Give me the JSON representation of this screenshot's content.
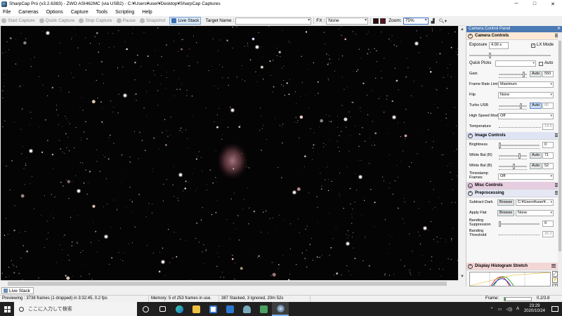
{
  "window": {
    "title": "SharpCap Pro (v3.2.6383) - ZWO ASI462MC (via USB2) - C:¥Users¥user¥Desktop¥SharpCap Captures",
    "minimize": "─",
    "maximize": "□",
    "close": "✕"
  },
  "menu": [
    "File",
    "Cameras",
    "Options",
    "Capture",
    "Tools",
    "Scripting",
    "Help"
  ],
  "toolbar": {
    "start_capture": "Start Capture",
    "quick_capture": "Quick Capture",
    "stop_capture": "Stop Capture",
    "pause": "Pause",
    "snapshot": "Snapshot",
    "live_stack": "Live Stack",
    "target_name_label": "Target Name :",
    "target_name_value": "",
    "fx_label": "FX :",
    "fx_value": "None",
    "zoom_label": "Zoom:",
    "zoom_value": "75%"
  },
  "viewer": {
    "nebula_color": "#b0707a"
  },
  "live_stack_tab": "Live Stack",
  "status": {
    "previewing": "Previewing : 3738 frames (1 dropped) in 3:32:45, 0.2 fps",
    "memory": "Memory: 5 of 253 frames in use.",
    "stacked": "387 Stacked, 3 Ignored, 20m 52s",
    "frame_label": "Frame:",
    "frame_value": "0.2/3.8",
    "frame_fraction": 0.05
  },
  "taskbar": {
    "search_placeholder": "ここに入力して検索",
    "time": "23:29",
    "date": "2020/10/24",
    "ime": "A",
    "icons": [
      "task-view-icon",
      "edge-icon",
      "file-explorer-icon",
      "store-icon",
      "mail-icon",
      "photos-icon",
      "app-icon",
      "sharpcap-icon"
    ]
  },
  "panel": {
    "title": "Camera Control Panel",
    "pin": "✕",
    "camera_controls": {
      "header": "Camera Controls",
      "exposure_label": "Exposure",
      "exposure_value": "4.00 s",
      "lx_mode_label": "LX Mode",
      "lx_mode_checked": "✓",
      "quick_picks_label": "Quick Picks",
      "quick_picks_value": "",
      "auto_label": "Auto",
      "gain_label": "Gain",
      "gain_auto": "Auto",
      "gain_value": "550",
      "frame_rate_limit_label": "Frame Rate Limit",
      "frame_rate_limit_value": "Maximum",
      "flip_label": "Flip",
      "flip_value": "None",
      "turbo_usb_label": "Turbo USB",
      "turbo_usb_auto": "Auto",
      "turbo_usb_value": "80",
      "high_speed_label": "High Speed Mode",
      "high_speed_value": "Off",
      "temperature_label": "Temperature",
      "temperature_value": "14.5"
    },
    "image_controls": {
      "header": "Image Controls",
      "brightness_label": "Brightness",
      "brightness_value": "0",
      "wb_r_label": "White Bal (R)",
      "wb_r_auto": "Auto",
      "wb_r_value": "71",
      "wb_b_label": "White Bal (B)",
      "wb_b_auto": "Auto",
      "wb_b_value": "52",
      "timestamp_label_1": "Timestamp",
      "timestamp_label_2": "Frames",
      "timestamp_value": "Off"
    },
    "misc_controls": {
      "header": "Misc Controls"
    },
    "preprocessing": {
      "header": "Preprocessing",
      "subtract_dark_label": "Subtract Dark",
      "subtract_dark_browse": "Browse",
      "subtract_dark_value": "C:¥Users¥user¥...",
      "apply_flat_label": "Apply Flat",
      "apply_flat_browse": "Browse",
      "apply_flat_value": "None",
      "banding_supp_label_1": "Banding",
      "banding_supp_label_2": "Suppression",
      "banding_supp_value": "0",
      "banding_thr_label_1": "Banding",
      "banding_thr_label_2": "Threshold",
      "banding_thr_value": "35.0"
    },
    "histogram": {
      "header": "Display Histogram Stretch"
    }
  }
}
